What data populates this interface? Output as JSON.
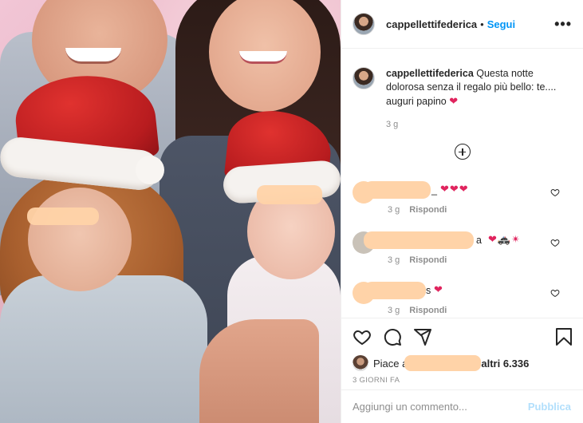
{
  "post": {
    "username": "cappellettifederica",
    "follow_label": "Segui",
    "more_label": "•••",
    "dot": "•",
    "caption_user": "cappellettifederica",
    "caption_text": "Questa notte dolorosa senza il regalo più bello: te.... auguri papino",
    "caption_emoji": "❤",
    "caption_time": "3 g"
  },
  "comments": [
    {
      "tail": "_",
      "emojis": "❤❤❤",
      "time": "3 g",
      "reply": "Rispondi"
    },
    {
      "tail": "a",
      "emojis": "❤🚓✴",
      "time": "3 g",
      "reply": "Rispondi"
    },
    {
      "tail": "s",
      "emojis": "❤",
      "time": "3 g",
      "reply": "Rispondi"
    }
  ],
  "likes": {
    "prefix": "Piace a",
    "suffix": "altri 6.336"
  },
  "date_label": "3 GIORNI FA",
  "add_comment": {
    "placeholder": "Aggiungi un commento...",
    "publish_label": "Pubblica"
  },
  "icons": [
    "heart-icon",
    "comment-icon",
    "share-icon",
    "bookmark-icon",
    "plus-circle-icon",
    "more-icon"
  ],
  "colors": {
    "link": "#0095f6",
    "publish_disabled": "#b2dffc",
    "heart": "#e0245e",
    "redaction": "#ffd3a8"
  }
}
